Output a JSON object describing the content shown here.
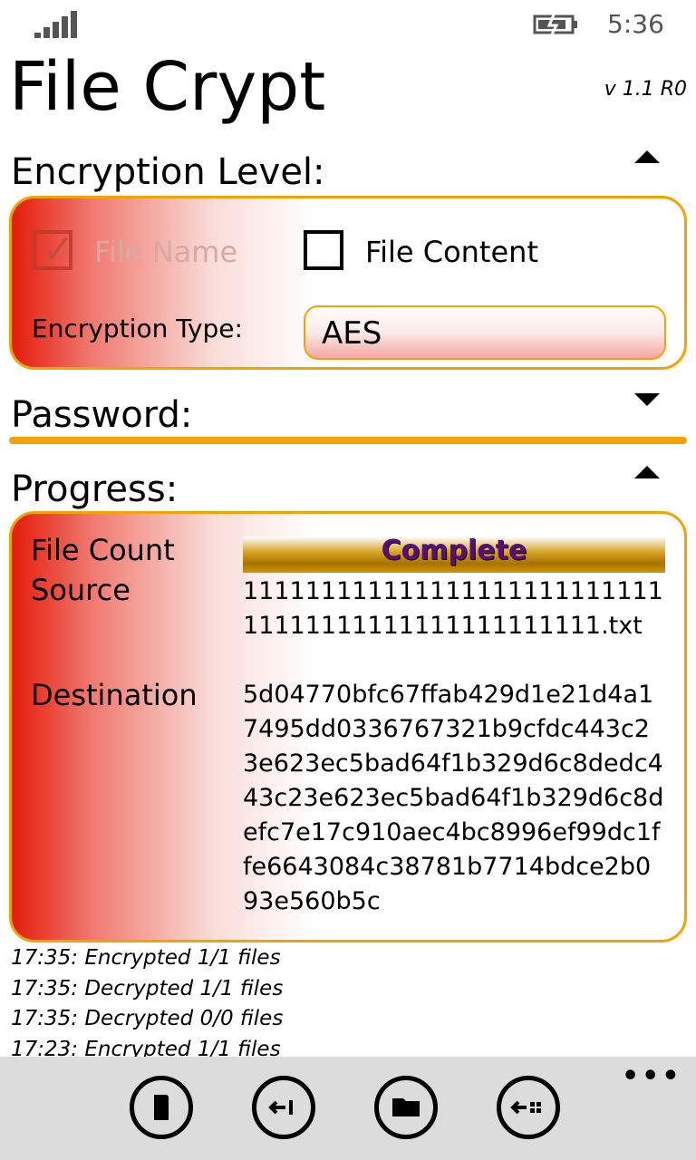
{
  "status": {
    "time": "5:36"
  },
  "app": {
    "title": "File Crypt",
    "version": "v 1.1 R0"
  },
  "encryption": {
    "label": "Encryption Level:",
    "file_name": {
      "label": "File Name",
      "checked": true,
      "enabled": false
    },
    "file_content": {
      "label": "File Content",
      "checked": false,
      "enabled": true
    },
    "type_label": "Encryption Type:",
    "type_value": "AES"
  },
  "password": {
    "label": "Password:"
  },
  "progress": {
    "label": "Progress:",
    "file_count_label": "File Count",
    "status_text": "Complete",
    "source_label": "Source",
    "source_value": "11111111111111111111111111111111111111111111111111.txt",
    "destination_label": "Destination",
    "destination_value": "5d04770bfc67ffab429d1e21d4a17495dd0336767321b9cfdc443c23e623ec5bad64f1b329d6c8dedc443c23e623ec5bad64f1b329d6c8defc7e17c910aec4bc8996ef99dc1ffe6643084c38781b7714bdce2b093e560b5c"
  },
  "log": [
    "17:35: Encrypted 1/1 files",
    "17:35: Decrypted 1/1 files",
    "17:35: Decrypted 0/0 files",
    "17:23: Encrypted 1/1 files"
  ],
  "appbar": {
    "buttons": [
      {
        "icon": "sd-card-icon"
      },
      {
        "icon": "back-arrow-icon"
      },
      {
        "icon": "folder-icon"
      },
      {
        "icon": "back-grid-icon"
      }
    ],
    "more": "•••"
  },
  "colors": {
    "accent": "#f3a300",
    "gradient_red": "#e41b0a",
    "progress_text": "#5b0b7a"
  }
}
